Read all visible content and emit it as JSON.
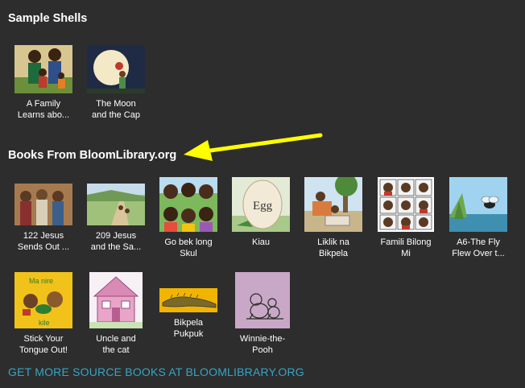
{
  "sections": [
    {
      "title": "Sample Shells"
    },
    {
      "title": "Books From BloomLibrary.org"
    }
  ],
  "sample_shells": [
    {
      "title": "A Family\nLearns abo...",
      "image": "family-illustration"
    },
    {
      "title": "The Moon\nand the Cap",
      "image": "moon-child-illustration"
    }
  ],
  "library_books": [
    {
      "title": "122 Jesus\nSends Out ...",
      "image": "jesus-crowd-illustration"
    },
    {
      "title": "209 Jesus\nand the Sa...",
      "image": "path-landscape-illustration"
    },
    {
      "title": "Go bek long\nSkul",
      "image": "children-illustration"
    },
    {
      "title": "Kiau",
      "image": "egg-illustration"
    },
    {
      "title": "Liklik na\nBikpela",
      "image": "village-illustration"
    },
    {
      "title": "Famili Bilong\nMi",
      "image": "family-faces-grid"
    },
    {
      "title": "A6-The Fly\nFlew Over t...",
      "image": "fly-landscape-illustration"
    },
    {
      "title": "Stick Your\nTongue Out!",
      "image": "animals-illustration",
      "cover_text_top": "Ma nire",
      "cover_text_bottom": "kile"
    },
    {
      "title": "Uncle and\nthe cat",
      "image": "pink-house-illustration"
    },
    {
      "title": "Bikpela\nPukpuk",
      "image": "crocodile-illustration"
    },
    {
      "title": "Winnie-the-\nPooh",
      "image": "pooh-sketch"
    }
  ],
  "egg_label": "Egg",
  "get_more_link": "GET MORE SOURCE BOOKS AT BLOOMLIBRARY.ORG",
  "colors": {
    "background": "#2d2d2d",
    "link": "#35a6c6",
    "arrow": "#ffff00"
  }
}
